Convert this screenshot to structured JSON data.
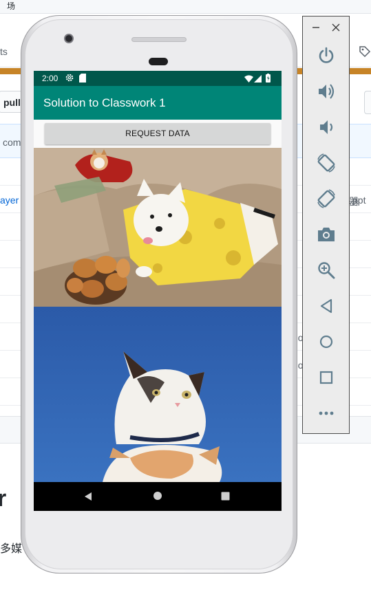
{
  "background_page": {
    "top_char": "场",
    "nav_left_fragment": "ts",
    "branch_button": "pull",
    "commit_fragment": "com",
    "link_fragment": "ayer",
    "right_fragments": [
      "器",
      "ppt",
      "no",
      "no"
    ],
    "heading_fragment": "r",
    "paragraph_fragment": "多媒"
  },
  "emulator": {
    "status_bar": {
      "time": "2:00"
    },
    "app_bar": {
      "title": "Solution to Classwork 1"
    },
    "request_button": {
      "label": "REQUEST DATA"
    },
    "images": [
      {
        "name": "westie-dog-costume-photo"
      },
      {
        "name": "cat-looking-up-photo"
      }
    ],
    "nav_bar": [
      "back-icon",
      "home-icon",
      "recents-icon"
    ]
  },
  "toolbar": {
    "window_controls": [
      "minimize-icon",
      "close-icon"
    ],
    "buttons": [
      "power-icon",
      "volume-up-icon",
      "volume-down-icon",
      "rotate-left-icon",
      "rotate-right-icon",
      "camera-icon",
      "zoom-icon",
      "back-icon",
      "home-icon",
      "overview-icon",
      "more-icon"
    ],
    "icon_color": "#5f7d8e"
  },
  "colors": {
    "status_bar": "#00574b",
    "app_bar": "#008577",
    "accent_orange": "#c78427"
  }
}
